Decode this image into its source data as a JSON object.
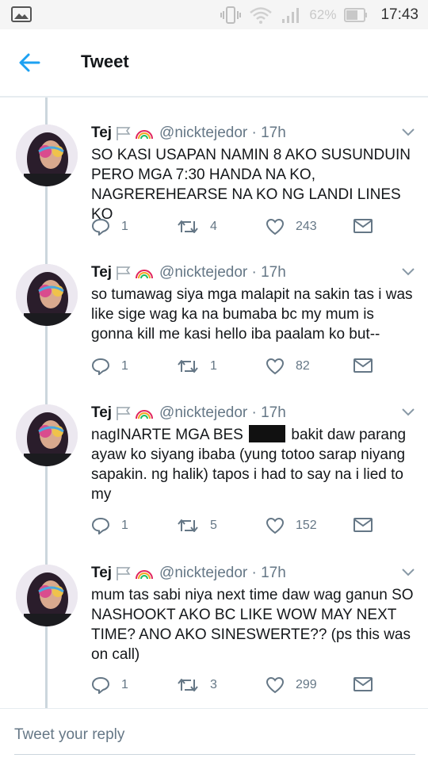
{
  "status_bar": {
    "battery": "62%",
    "time": "17:43"
  },
  "app_bar": {
    "title": "Tweet"
  },
  "tweets": [
    {
      "name": "Tej",
      "handle": "@nicktejedor",
      "time": "· 17h",
      "text": "SO KASI USAPAN NAMIN 8 AKO SUSUNDUIN PERO MGA 7:30 HANDA NA KO, NAGREREHEARSE NA KO NG LANDI LINES KO",
      "replies": "1",
      "retweets": "4",
      "likes": "243"
    },
    {
      "name": "Tej",
      "handle": "@nicktejedor",
      "time": "· 17h",
      "text": "so tumawag siya mga malapit na sakin tas i was like sige wag ka na bumaba bc my mum is gonna kill me kasi hello iba paalam ko but--",
      "replies": "1",
      "retweets": "1",
      "likes": "82"
    },
    {
      "name": "Tej",
      "handle": "@nicktejedor",
      "time": "· 17h",
      "text_before": "nagINARTE MGA BES",
      "text_after": "bakit daw parang ayaw ko siyang ibaba (yung totoo sarap niyang sapakin. ng halik) tapos i had to say na i lied to my",
      "replies": "1",
      "retweets": "5",
      "likes": "152"
    },
    {
      "name": "Tej",
      "handle": "@nicktejedor",
      "time": "· 17h",
      "text": "mum tas sabi niya next time daw wag ganun SO NASHOOKT AKO BC LIKE WOW MAY NEXT TIME? ANO AKO SINESWERTE?? (ps this was on call)",
      "replies": "1",
      "retweets": "3",
      "likes": "299"
    }
  ],
  "reply": {
    "placeholder": "Tweet your reply"
  },
  "colors": {
    "accent": "#1da1f2",
    "text": "#14171a",
    "muted": "#657786",
    "divider": "#e6ecf0"
  }
}
